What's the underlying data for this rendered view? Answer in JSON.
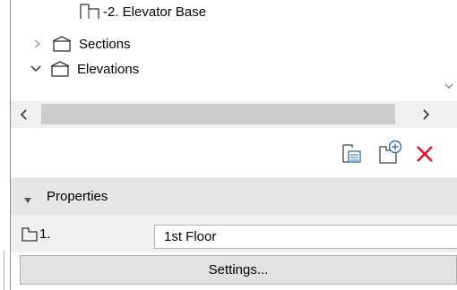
{
  "tree": {
    "items": [
      {
        "label": "-2. Elevator Base",
        "icon": "story-icon"
      },
      {
        "label": "Sections",
        "icon": "section-folder-icon",
        "expanded": false
      },
      {
        "label": "Elevations",
        "icon": "elevation-folder-icon",
        "expanded": true
      }
    ]
  },
  "toolbar": {
    "icons": [
      "view-settings-icon",
      "new-story-icon",
      "delete-icon"
    ],
    "delete_color": "#e81123"
  },
  "properties": {
    "header_label": "Properties",
    "story_number": "1.",
    "story_name": "1st Floor",
    "settings_label": "Settings..."
  }
}
